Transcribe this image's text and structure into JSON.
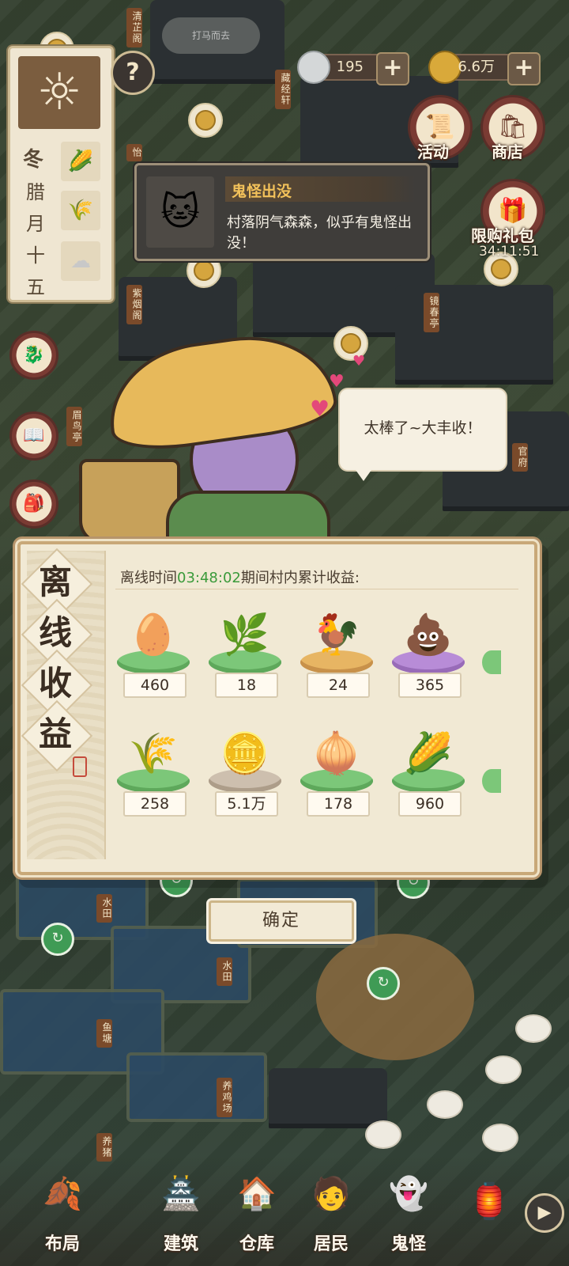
{
  "top_pill_text": "打马而去",
  "calendar": {
    "season": "冬",
    "date_chars": [
      "腊",
      "月",
      "十",
      "五"
    ],
    "icons": [
      "corn-icon",
      "wheat-icon",
      "cloud-icon"
    ]
  },
  "help_label": "?",
  "currency": {
    "silver": "195",
    "coins": "6.6万",
    "plus": "+"
  },
  "side_buttons": {
    "activity": "活动",
    "shop": "商店",
    "limited_gift": "限购礼包",
    "limited_timer": "34:11:51"
  },
  "notice": {
    "title": "鬼怪出没",
    "body": "村落阴气森森，似乎有鬼怪出没！"
  },
  "speech": "太棒了~大丰收！",
  "map_signs": [
    "清芷阁",
    "藏经轩",
    "怡",
    "紫烟阁",
    "镜春亭",
    "眉鸟亭",
    "官府",
    "水田",
    "水田",
    "鱼塘",
    "养鸡场",
    "养猪"
  ],
  "offline_panel": {
    "title_chars": [
      "离",
      "线",
      "收",
      "益"
    ],
    "subtitle_prefix": "离线时间",
    "subtitle_time": "03:48:02",
    "subtitle_suffix": "期间村内累计收益:",
    "rows": [
      [
        {
          "name": "egg",
          "count": "460"
        },
        {
          "name": "grass",
          "count": "18"
        },
        {
          "name": "chicken",
          "count": "24"
        },
        {
          "name": "manure",
          "count": "365"
        }
      ],
      [
        {
          "name": "wheat",
          "count": "258"
        },
        {
          "name": "coin",
          "count": "5.1万"
        },
        {
          "name": "scallion",
          "count": "178"
        },
        {
          "name": "corn",
          "count": "960"
        }
      ]
    ]
  },
  "confirm_label": "确定",
  "bottom_nav": [
    "布局",
    "建筑",
    "仓库",
    "居民",
    "鬼怪"
  ],
  "colors": {
    "accent_time": "#3a9a3a",
    "notice_title": "#f2c15a"
  }
}
